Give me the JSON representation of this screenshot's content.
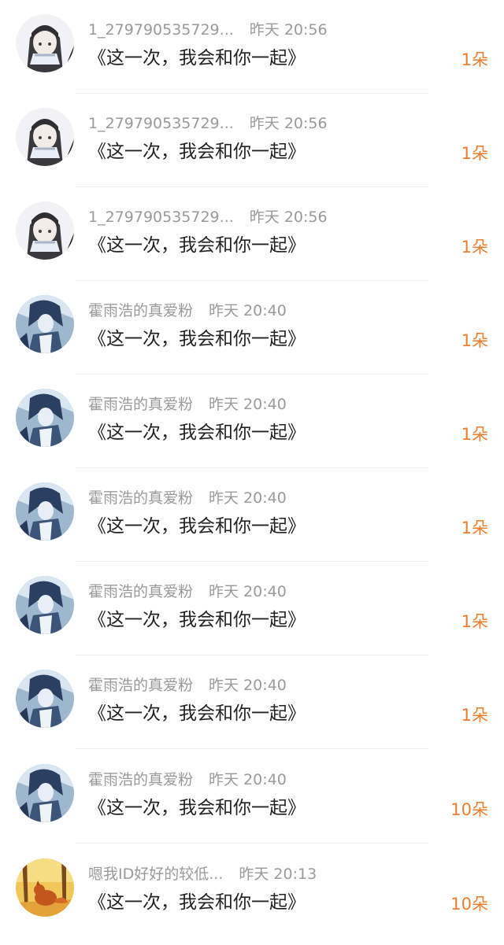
{
  "colors": {
    "accent": "#ee7d2c",
    "meta": "#9a9a9a",
    "title": "#222222"
  },
  "items": [
    {
      "name": "1_279790535729...",
      "time": "昨天 20:56",
      "title": "《这一次，我会和你一起》",
      "count": "1朵",
      "avatar": "avatar-girl-scarf"
    },
    {
      "name": "1_279790535729...",
      "time": "昨天 20:56",
      "title": "《这一次，我会和你一起》",
      "count": "1朵",
      "avatar": "avatar-girl-scarf"
    },
    {
      "name": "1_279790535729...",
      "time": "昨天 20:56",
      "title": "《这一次，我会和你一起》",
      "count": "1朵",
      "avatar": "avatar-girl-scarf"
    },
    {
      "name": "霍雨浩的真爱粉",
      "time": "昨天 20:40",
      "title": "《这一次，我会和你一起》",
      "count": "1朵",
      "avatar": "avatar-blue-boy"
    },
    {
      "name": "霍雨浩的真爱粉",
      "time": "昨天 20:40",
      "title": "《这一次，我会和你一起》",
      "count": "1朵",
      "avatar": "avatar-blue-boy"
    },
    {
      "name": "霍雨浩的真爱粉",
      "time": "昨天 20:40",
      "title": "《这一次，我会和你一起》",
      "count": "1朵",
      "avatar": "avatar-blue-boy"
    },
    {
      "name": "霍雨浩的真爱粉",
      "time": "昨天 20:40",
      "title": "《这一次，我会和你一起》",
      "count": "1朵",
      "avatar": "avatar-blue-boy"
    },
    {
      "name": "霍雨浩的真爱粉",
      "time": "昨天 20:40",
      "title": "《这一次，我会和你一起》",
      "count": "1朵",
      "avatar": "avatar-blue-boy"
    },
    {
      "name": "霍雨浩的真爱粉",
      "time": "昨天 20:40",
      "title": "《这一次，我会和你一起》",
      "count": "10朵",
      "avatar": "avatar-blue-boy"
    },
    {
      "name": "嗯我ID好好的较低...",
      "time": "昨天 20:13",
      "title": "《这一次，我会和你一起》",
      "count": "10朵",
      "avatar": "avatar-autumn-fox"
    }
  ]
}
